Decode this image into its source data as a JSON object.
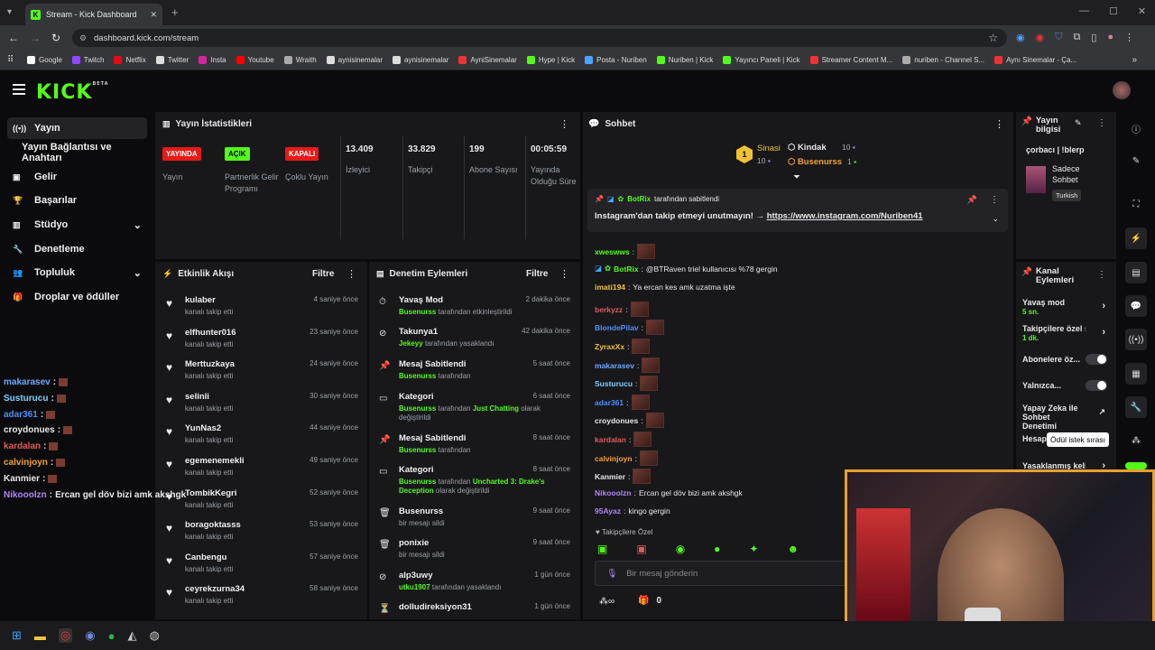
{
  "browser": {
    "tab_title": "Stream - Kick Dashboard",
    "url": "dashboard.kick.com/stream",
    "bookmarks": [
      "Google",
      "Twitch",
      "Netflix",
      "Twitter",
      "Insta",
      "Youtube",
      "Wraith",
      "aynisinemalar",
      "aynisinemalar",
      "AyniSinemalar",
      "Hype | Kick",
      "Posta - Nuriben",
      "Nuriben | Kick",
      "Yayıncı Paneli | Kick",
      "Streamer Content M...",
      "nuriben - Channel S...",
      "Aynı Sinemalar - Ça..."
    ]
  },
  "app": {
    "logo": "KICK",
    "logo_badge": "BETA"
  },
  "sidebar": {
    "items": [
      "Yayın",
      "Yayın Bağlantısı ve Anahtarı",
      "Gelir",
      "Başarılar",
      "Stüdyo",
      "Denetleme",
      "Topluluk",
      "Droplar ve ödüller"
    ]
  },
  "stats": {
    "title": "Yayın İstatistikleri",
    "items": [
      {
        "badge": "YAYINDA",
        "label": "Yayın"
      },
      {
        "badge": "AÇIK",
        "label": "Partnerlik Gelir Programı"
      },
      {
        "badge": "KAPALI",
        "label": "Çoklu Yayın"
      },
      {
        "value": "13.409",
        "label": "İzleyici"
      },
      {
        "value": "33.829",
        "label": "Takipçi"
      },
      {
        "value": "199",
        "label": "Abone Sayısı"
      },
      {
        "value": "00:05:59",
        "label": "Yayında Olduğu Süre"
      }
    ]
  },
  "activity": {
    "title": "Etkinlik Akışı",
    "filter": "Filtre",
    "items": [
      {
        "name": "kulaber",
        "sub": "kanalı takip etti",
        "time": "4 saniye önce"
      },
      {
        "name": "elfhunter016",
        "sub": "kanalı takip etti",
        "time": "23 saniye önce"
      },
      {
        "name": "Merttuzkaya",
        "sub": "kanalı takip etti",
        "time": "24 saniye önce"
      },
      {
        "name": "selinli",
        "sub": "kanalı takip etti",
        "time": "30 saniye önce"
      },
      {
        "name": "YunNas2",
        "sub": "kanalı takip etti",
        "time": "44 saniye önce"
      },
      {
        "name": "egemenemekli",
        "sub": "kanalı takip etti",
        "time": "49 saniye önce"
      },
      {
        "name": "TombikKegri",
        "sub": "kanalı takip etti",
        "time": "52 saniye önce"
      },
      {
        "name": "boragoktasss",
        "sub": "kanalı takip etti",
        "time": "53 saniye önce"
      },
      {
        "name": "Canbengu",
        "sub": "kanalı takip etti",
        "time": "57 saniye önce"
      },
      {
        "name": "ceyrekzurna34",
        "sub": "kanalı takip etti",
        "time": "58 saniye önce"
      }
    ]
  },
  "moderation": {
    "title": "Denetim Eylemleri",
    "filter": "Filtre",
    "items": [
      {
        "title": "Yavaş Mod",
        "user": "Busenurss",
        "rest": "tarafından etkinleştirildi",
        "time": "2 dakika önce"
      },
      {
        "title": "Takunya1",
        "user": "Jekeyy",
        "rest": "tarafından yasaklandı",
        "time": "42 dakika önce"
      },
      {
        "title": "Mesaj Sabitlendi",
        "user": "Busenurss",
        "rest": "tarafından",
        "time": "5 saat önce"
      },
      {
        "title": "Kategori",
        "user": "Busenurss",
        "rest": "tarafından",
        "extra": "Just Chatting",
        "rest2": "olarak değiştirildi",
        "time": "6 saat önce"
      },
      {
        "title": "Mesaj Sabitlendi",
        "user": "Busenurss",
        "rest": "tarafından",
        "time": "8 saat önce"
      },
      {
        "title": "Kategori",
        "user": "Busenurss",
        "rest": "tarafından",
        "extra": "Uncharted 3: Drake's Deception",
        "rest2": "olarak değiştirildi",
        "time": "8 saat önce"
      },
      {
        "title": "Busenurss",
        "user": "",
        "rest": "bir mesajı sildi",
        "time": "9 saat önce"
      },
      {
        "title": "ponixie",
        "user": "",
        "rest": "bir mesajı sildi",
        "time": "9 saat önce"
      },
      {
        "title": "alp3uwy",
        "user": "utku1907",
        "rest": "tarafından yasaklandı",
        "time": "1 gün önce"
      },
      {
        "title": "dolludireksiyon31",
        "user": "",
        "rest": "",
        "time": "1 gün önce"
      }
    ]
  },
  "chat": {
    "title": "Sohbet",
    "top": [
      {
        "rank": "1",
        "name": "Sinasi",
        "count": "10"
      },
      {
        "name": "Kindak",
        "count": "10"
      },
      {
        "name": "Busenurss",
        "count": "1"
      }
    ],
    "pinned": {
      "by": "BotRix",
      "by_suffix": "tarafından sabitlendi",
      "text": "Instagram'dan takip etmeyi unutmayın! →",
      "link": "https://www.instagram.com/Nuriben41"
    },
    "messages": [
      {
        "user": "xweswws",
        "color": "#53fc18",
        "emote": true
      },
      {
        "user": "BotRix",
        "color": "#53fc18",
        "text": "@BTRaven triel kullanıcısı %78 gergin",
        "bot": true
      },
      {
        "user": "imati194",
        "color": "#f1c232",
        "text": "Ya ercan kes amk uzatma işte"
      },
      {
        "user": "berkyzz",
        "color": "#e05a5a",
        "emote": true
      },
      {
        "user": "BlondePilav",
        "color": "#4f8ef7",
        "emote": true
      },
      {
        "user": "ZyraxXx",
        "color": "#f1c232",
        "emote": true
      },
      {
        "user": "makarasev",
        "color": "#6ea8fe",
        "emote": true
      },
      {
        "user": "Susturucu",
        "color": "#7fd1ff",
        "emote": true
      },
      {
        "user": "adar361",
        "color": "#4f8ef7",
        "emote": true
      },
      {
        "user": "croydonues",
        "color": "#e8e8e8",
        "emote": true
      },
      {
        "user": "kardalan",
        "color": "#e05a5a",
        "emote": true
      },
      {
        "user": "calvinjoyn",
        "color": "#f1a232",
        "emote": true
      },
      {
        "user": "Kanmier",
        "color": "#e8e8e8",
        "emote": true
      },
      {
        "user": "Nikooolzn",
        "color": "#b084f7",
        "text": "Ercan gel döv bizi amk akshgk"
      },
      {
        "user": "95Ayaz",
        "color": "#b084f7",
        "text": "kingo gergin"
      }
    ],
    "followers_only": "Takipçilere Özel",
    "placeholder": "Bir mesaj gönderin",
    "count_a": "0"
  },
  "info": {
    "title": "Yayın bilgisi",
    "stream_title": "çorbacı | !blerp",
    "category": "Sadece Sohbet",
    "language": "Turkish"
  },
  "channel": {
    "title": "Kanal Eylemleri",
    "items": [
      {
        "label": "Yavaş mod",
        "sub": "5 sn."
      },
      {
        "label": "Takipçilere özel s",
        "sub": "1 dk."
      },
      {
        "label": "Abonelere öz..."
      },
      {
        "label": "Yalnızca..."
      },
      {
        "label": "Yapay Zeka ile Sohbet Denetimi"
      },
      {
        "label": "Hesap"
      },
      {
        "label": "Yasaklanmış kelin"
      }
    ],
    "tooltip": "Ödül istek sırası"
  },
  "overlay": [
    {
      "user": "makarasev",
      "color": "#6ea8fe"
    },
    {
      "user": "Susturucu",
      "color": "#7fd1ff"
    },
    {
      "user": "adar361",
      "color": "#4f8ef7"
    },
    {
      "user": "croydonues",
      "color": "#e8e8e8"
    },
    {
      "user": "kardalan",
      "color": "#e05a5a"
    },
    {
      "user": "calvinjoyn",
      "color": "#f1a232"
    },
    {
      "user": "Kanmier",
      "color": "#e8e8e8"
    },
    {
      "user": "Nikooolzn",
      "color": "#b084f7",
      "text": "Ercan gel döv bizi amk akshgk"
    }
  ],
  "colors": {
    "accent": "#53fc18",
    "live": "#e91916"
  }
}
